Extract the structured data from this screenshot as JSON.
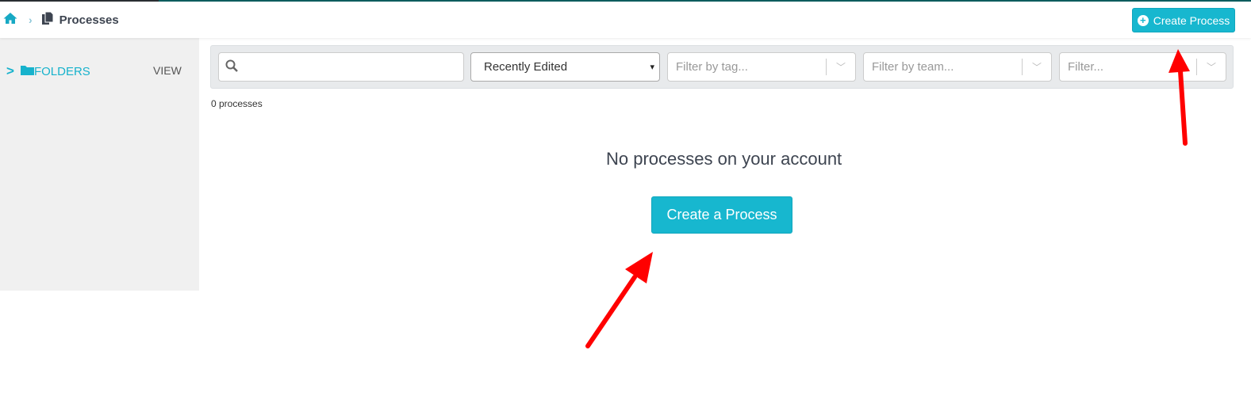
{
  "header": {
    "breadcrumb_title": "Processes",
    "create_button": "Create Process"
  },
  "sidebar": {
    "folders_label": "FOLDERS",
    "view_label": "VIEW"
  },
  "filters": {
    "search_placeholder": "",
    "sort_selected": "Recently Edited",
    "tag_placeholder": "Filter by tag...",
    "team_placeholder": "Filter by team...",
    "other_placeholder": "Filter..."
  },
  "main": {
    "count": "0 processes",
    "empty_message": "No processes on your account",
    "create_button": "Create a Process"
  },
  "colors": {
    "accent": "#17b7cf",
    "annotation_arrow": "#ff0000"
  }
}
